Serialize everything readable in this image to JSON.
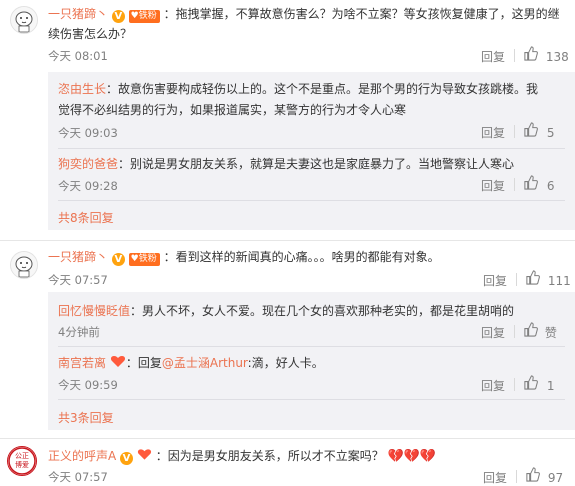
{
  "colors": {
    "username": "#eb7350",
    "text": "#333333",
    "meta": "#808080",
    "reply_bg": "#f2f2f5"
  },
  "comments": [
    {
      "user": "一只猪蹄丶",
      "text_line1": "：拖拽掌握，不算故意伤害么？为啥不立案？等女孩恢复健康了，这男的继",
      "text_line2": "续伤害怎么办？",
      "time": "今天 08:01",
      "reply_label": "回复",
      "likes": "138",
      "fan_badge": "铁粉",
      "replies": [
        {
          "user": "恣由生长",
          "text_line1": "：故意伤害要构成轻伤以上的。这个不是重点。是那个男的行为导致女孩跳楼。我",
          "text_line2": "觉得不必纠结男的行为，如果报道属实，某警方的行为才令人心寒",
          "time": "今天 09:03",
          "likes": "5"
        },
        {
          "user": "狗奕的爸爸",
          "text_line1": "：别说是男女朋友关系，就算是夫妻这也是家庭暴力了。当地警察让人寒心",
          "time": "今天 09:28",
          "likes": "6"
        }
      ],
      "more": "共8条回复"
    },
    {
      "user": "一只猪蹄丶",
      "text_line1": "：看到这样的新闻真的心痛。。。啥男的都能有对象。",
      "time": "今天 07:57",
      "reply_label": "回复",
      "likes": "111",
      "fan_badge": "铁粉",
      "replies": [
        {
          "user": "回忆慢慢眨值",
          "text_line1": "：男人不坏，女人不爱。现在几个女的喜欢那种老实的，都是花里胡哨的",
          "time": "4分钟前",
          "likes": "赞"
        },
        {
          "user": "南宫若离",
          "text_prefix": "：回复",
          "mention": "@孟士涵Arthur",
          "text_line1": ":滴，好人卡。",
          "time": "今天 09:59",
          "likes": "1"
        }
      ],
      "more": "共3条回复"
    },
    {
      "user": "正义的呼声A",
      "text_line1": "：因为是男女朋友关系，所以才不立案吗？",
      "time": "今天 07:57",
      "reply_label": "回复",
      "likes": "97",
      "avatar_text": "公正博爱"
    }
  ],
  "reply_label": "回复",
  "icons": [
    "thumb-up-icon",
    "v-verified-icon",
    "fan-badge-icon",
    "heart-icon",
    "broken-heart-emoji-icon"
  ]
}
